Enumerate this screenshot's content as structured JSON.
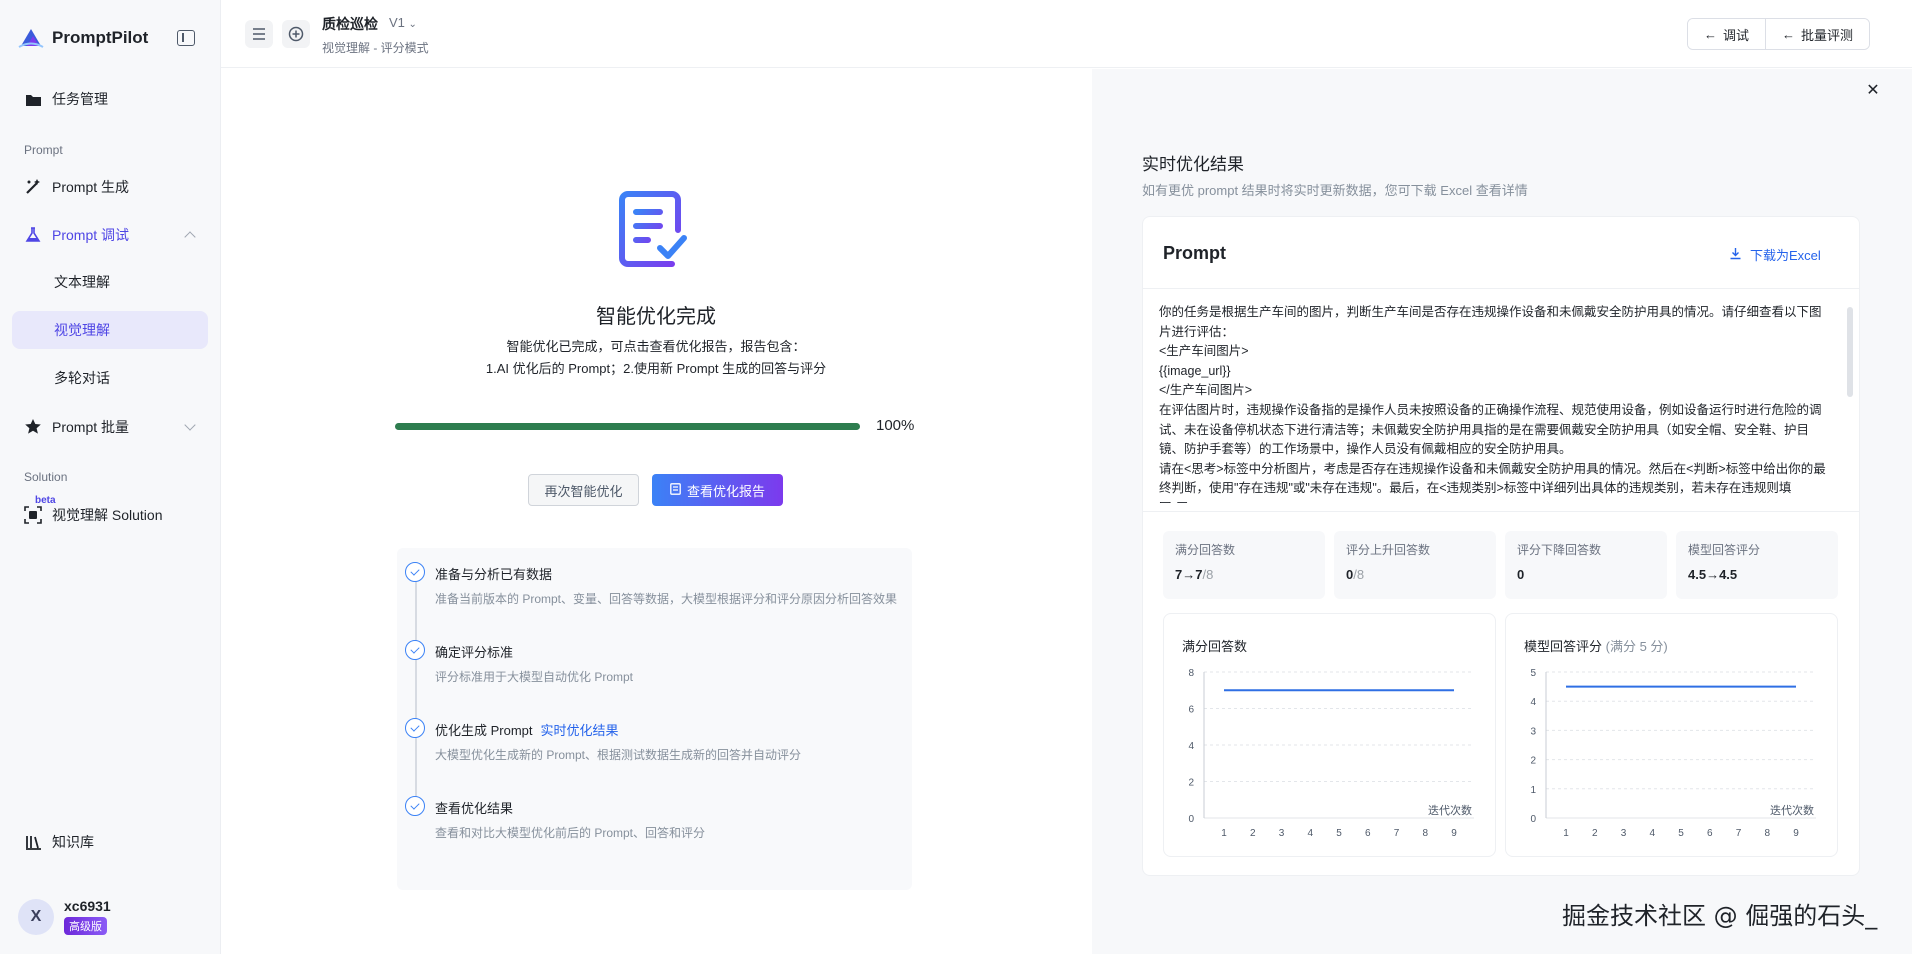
{
  "app": {
    "name": "PromptPilot"
  },
  "sidebar": {
    "items": [
      {
        "label": "任务管理",
        "icon": "folder-icon"
      },
      {
        "label": "Prompt 生成",
        "icon": "wand-icon"
      },
      {
        "label": "Prompt 调试",
        "icon": "flask-icon"
      },
      {
        "label": "文本理解"
      },
      {
        "label": "视觉理解"
      },
      {
        "label": "多轮对话"
      },
      {
        "label": "Prompt 批量",
        "icon": "batch-icon"
      },
      {
        "label": "视觉理解 Solution",
        "icon": "scan-icon"
      },
      {
        "label": "知识库",
        "icon": "library-icon"
      }
    ],
    "sections": {
      "prompt": "Prompt",
      "solution": "Solution"
    },
    "beta": "beta",
    "user": {
      "initial": "X",
      "name": "xc6931",
      "plan": "高级版"
    }
  },
  "header": {
    "title": "质检巡检",
    "version": "V1",
    "subtitle": "视觉理解 - 评分模式",
    "buttons": {
      "debug": "调试",
      "batch_eval": "批量评测"
    }
  },
  "completion": {
    "title": "智能优化完成",
    "desc_line1": "智能优化已完成，可点击查看优化报告，报告包含：",
    "desc_line2": "1.AI 优化后的 Prompt；2.使用新 Prompt 生成的回答与评分",
    "progress": 1.0,
    "progress_label": "100%",
    "retry_label": "再次智能优化",
    "report_label": "查看优化报告"
  },
  "steps": [
    {
      "title": "准备与分析已有数据",
      "desc": "准备当前版本的 Prompt、变量、回答等数据，大模型根据评分和评分原因分析回答效果"
    },
    {
      "title": "确定评分标准",
      "desc": "评分标准用于大模型自动优化 Prompt"
    },
    {
      "title": "优化生成 Prompt",
      "link": "实时优化结果",
      "desc": "大模型优化生成新的 Prompt、根据测试数据生成新的回答并自动评分"
    },
    {
      "title": "查看优化结果",
      "desc": "查看和对比大模型优化前后的 Prompt、回答和评分"
    }
  ],
  "results": {
    "title": "实时优化结果",
    "subtitle": "如有更优 prompt 结果时将实时更新数据，您可下载 Excel 查看详情",
    "card_title": "Prompt",
    "download_label": "下载为Excel",
    "prompt_lines": [
      "你的任务是根据生产车间的图片，判断生产车间是否存在违规操作设备和未佩戴安全防护用具的情况。请仔细查看以下图片进行评估：",
      "<生产车间图片>",
      "{{image_url}}",
      "</生产车间图片>",
      "在评估图片时，违规操作设备指的是操作人员未按照设备的正确操作流程、规范使用设备，例如设备运行时进行危险的调试、未在设备停机状态下进行清洁等；未佩戴安全防护用具指的是在需要佩戴安全防护用具（如安全帽、安全鞋、护目镜、防护手套等）的工作场景中，操作人员没有佩戴相应的安全防护用具。",
      "请在<思考>标签中分析图片，考虑是否存在违规操作设备和未佩戴安全防护用具的情况。然后在<判断>标签中给出你的最终判断，使用\"存在违规\"或\"未存在违规\"。最后，在<违规类别>标签中详细列出具体的违规类别，若未存在违规则填写\"无\"。"
    ],
    "stats": [
      {
        "label": "满分回答数",
        "value": "7→7",
        "suffix": "/8"
      },
      {
        "label": "评分上升回答数",
        "value": "0",
        "suffix": "/8"
      },
      {
        "label": "评分下降回答数",
        "value": "0",
        "suffix": ""
      },
      {
        "label": "模型回答评分",
        "value": "4.5→4.5",
        "suffix": ""
      }
    ]
  },
  "chart_data": [
    {
      "type": "line",
      "title": "满分回答数",
      "xlabel": "迭代次数",
      "ylabel": "",
      "x": [
        1,
        2,
        3,
        4,
        5,
        6,
        7,
        8,
        9
      ],
      "xticks": [
        "1",
        "2",
        "3",
        "4",
        "5",
        "6",
        "7",
        "8",
        "9"
      ],
      "yticks": [
        "0",
        "2",
        "4",
        "6",
        "8"
      ],
      "ylim": [
        0,
        8
      ],
      "series": [
        {
          "values": [
            7,
            7,
            7,
            7,
            7,
            7,
            7,
            7,
            7
          ],
          "color": "#2f6fe4"
        }
      ],
      "grid": true
    },
    {
      "type": "line",
      "title": "模型回答评分",
      "title_note": "(满分 5 分)",
      "xlabel": "迭代次数",
      "ylabel": "",
      "x": [
        1,
        2,
        3,
        4,
        5,
        6,
        7,
        8,
        9
      ],
      "xticks": [
        "1",
        "2",
        "3",
        "4",
        "5",
        "6",
        "7",
        "8",
        "9"
      ],
      "yticks": [
        "0",
        "1",
        "2",
        "3",
        "4",
        "5"
      ],
      "ylim": [
        0,
        5
      ],
      "series": [
        {
          "values": [
            4.5,
            4.5,
            4.5,
            4.5,
            4.5,
            4.5,
            4.5,
            4.5,
            4.5
          ],
          "color": "#2f6fe4"
        }
      ],
      "grid": true
    }
  ],
  "watermark": "掘金技术社区 @ 倔强的石头_",
  "colors": {
    "accent": "#4f46e5",
    "link": "#2563eb",
    "progress": "#2e7d4f"
  }
}
